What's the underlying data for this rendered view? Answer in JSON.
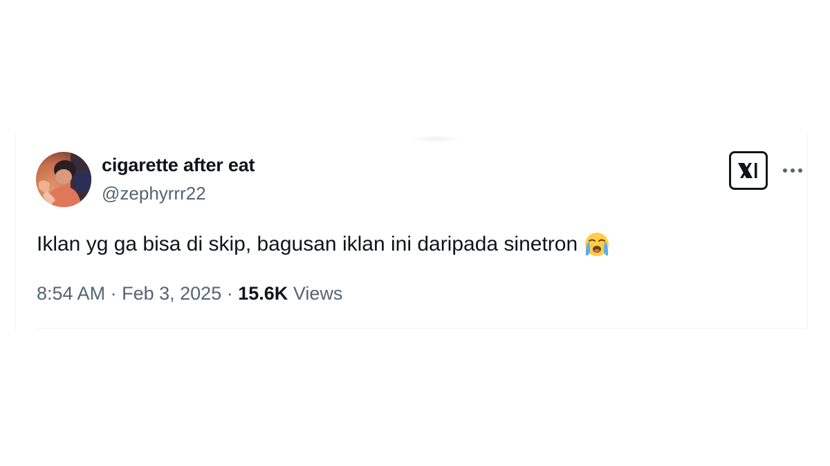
{
  "tweet": {
    "author": {
      "display_name": "cigarette after eat",
      "handle": "@zephyrrr22",
      "avatar_icon": "profile-photo"
    },
    "text": "Iklan yg ga bisa di skip, bagusan iklan ini daripada sinetron",
    "emoji": "loudly-crying-face",
    "time": "8:54 AM",
    "date": "Feb 3, 2025",
    "separator": "·",
    "views_count": "15.6K",
    "views_label": "Views",
    "platform_icon": "x-logo-icon",
    "more_icon": "more-dots-icon"
  },
  "colors": {
    "primary_text": "#0f1419",
    "secondary_text": "#536471",
    "divider": "#eff3f4",
    "background": "#ffffff"
  }
}
